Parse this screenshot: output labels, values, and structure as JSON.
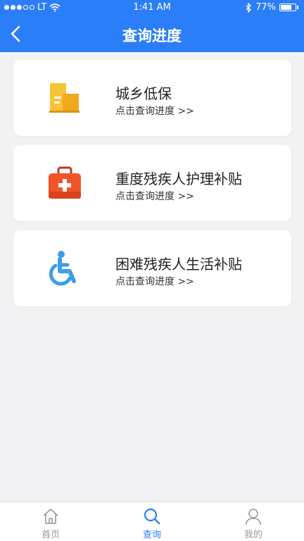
{
  "status_bar": {
    "carrier": "LT",
    "time": "1:41 AM",
    "battery": "77%",
    "battery_level": 0.77
  },
  "nav": {
    "title": "查询进度"
  },
  "cards": [
    {
      "title": "城乡低保",
      "subtitle": "点击查询进度 >>",
      "icon": "folder-icon"
    },
    {
      "title": "重度残疾人护理补贴",
      "subtitle": "点击查询进度 >>",
      "icon": "first-aid-kit-icon"
    },
    {
      "title": "困难残疾人生活补贴",
      "subtitle": "点击查询进度 >>",
      "icon": "wheelchair-icon"
    }
  ],
  "tabbar": {
    "items": [
      {
        "label": "首页",
        "icon": "home-icon"
      },
      {
        "label": "查询",
        "icon": "search-icon",
        "active": true
      },
      {
        "label": "我的",
        "icon": "user-icon"
      }
    ]
  },
  "colors": {
    "primary": "#2c7ef8",
    "folder": "#f5b31f",
    "kit": "#f0552a",
    "wheelchair": "#3c9de8",
    "background": "#f2f2f4"
  }
}
